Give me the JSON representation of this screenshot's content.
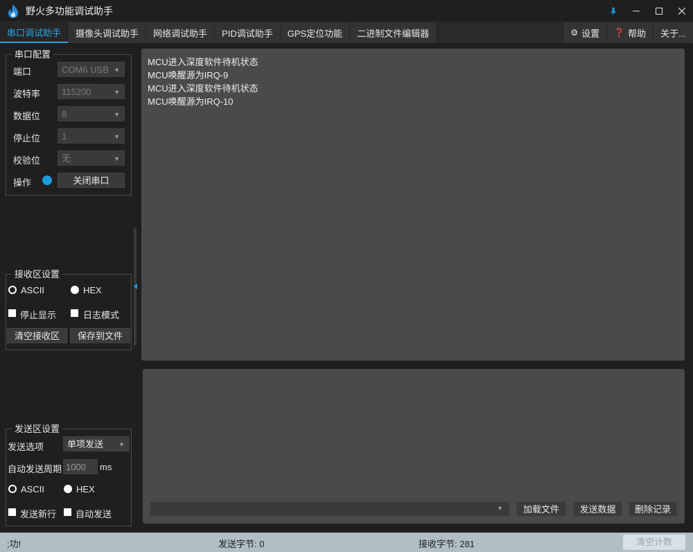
{
  "window": {
    "title": "野火多功能调试助手",
    "controls": [
      "pin-icon",
      "minimize-icon",
      "maximize-icon",
      "close-icon"
    ]
  },
  "tabs": [
    {
      "label": "串口调试助手",
      "active": true
    },
    {
      "label": "摄像头调试助手"
    },
    {
      "label": "网络调试助手"
    },
    {
      "label": "PID调试助手"
    },
    {
      "label": "GPS定位功能"
    },
    {
      "label": "二进制文件编辑器"
    }
  ],
  "tabs_right": [
    {
      "icon": "gear-icon",
      "glyph": "⚙",
      "label": "设置"
    },
    {
      "icon": "help-icon",
      "glyph": "❓",
      "label": "帮助"
    },
    {
      "label": "关于..."
    }
  ],
  "serial_config": {
    "title": "串口配置",
    "port_label": "端口",
    "port_value": "COM6 USB",
    "baud_label": "波特率",
    "baud_value": "115200",
    "databits_label": "数据位",
    "databits_value": "8",
    "stopbits_label": "停止位",
    "stopbits_value": "1",
    "parity_label": "校验位",
    "parity_value": "无",
    "operation_label": "操作",
    "close_port_label": "关闭串口",
    "status_color": "#1e9be0"
  },
  "receive_settings": {
    "title": "接收区设置",
    "ascii_label": "ASCII",
    "hex_label": "HEX",
    "selected": "ASCII",
    "stop_display_label": "停止显示",
    "log_mode_label": "日志模式",
    "clear_label": "清空接收区",
    "save_label": "保存到文件"
  },
  "send_settings": {
    "title": "发送区设置",
    "send_option_label": "发送选项",
    "send_option_value": "单项发送",
    "auto_period_label": "自动发送周期",
    "auto_period_value": "1000",
    "period_unit": "ms",
    "ascii_label": "ASCII",
    "hex_label": "HEX",
    "selected": "ASCII",
    "newline_label": "发送新行",
    "auto_send_label": "自动发送"
  },
  "receive_area": {
    "lines": [
      "MCU进入深度软件待机状态",
      "MCU唤醒源为IRQ-9",
      "MCU进入深度软件待机状态",
      "MCU唤醒源为IRQ-10"
    ]
  },
  "send_area": {
    "load_file_label": "加载文件",
    "send_data_label": "发送数据",
    "delete_record_label": "删除记录"
  },
  "statusbar": {
    "message": ";功!",
    "sent_bytes": "发送字节: 0",
    "recv_bytes": "接收字节: 281",
    "clear_count_label": "清空计数"
  }
}
